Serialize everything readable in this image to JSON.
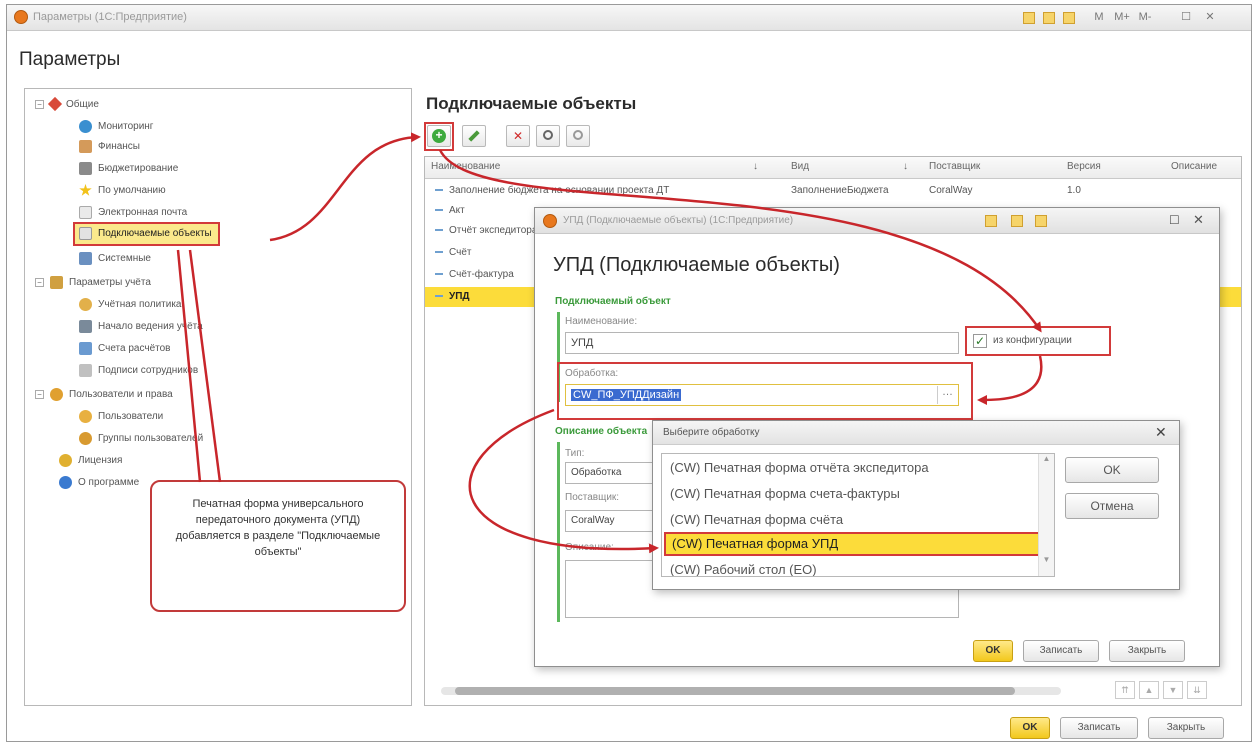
{
  "window": {
    "title": "Параметры (1С:Предприятие)",
    "tb_m": "M",
    "tb_mplus": "M+",
    "tb_mminus": "M-"
  },
  "page": {
    "title": "Параметры"
  },
  "tree": {
    "groups": [
      {
        "label": "Общие",
        "items": [
          "Мониторинг",
          "Финансы",
          "Бюджетирование",
          "По умолчанию",
          "Электронная почта",
          "Подключаемые объекты",
          "Системные"
        ]
      },
      {
        "label": "Параметры учёта",
        "items": [
          "Учётная политика",
          "Начало ведения учёта",
          "Счета расчётов",
          "Подписи сотрудников"
        ]
      },
      {
        "label": "Пользователи и права",
        "items": [
          "Пользователи",
          "Группы пользователей"
        ]
      }
    ],
    "extra": [
      "Лицензия",
      "О программе"
    ]
  },
  "section": {
    "title": "Подключаемые объекты"
  },
  "grid": {
    "columns": [
      "Наименование",
      "Вид",
      "Поставщик",
      "Версия",
      "Описание"
    ],
    "rows": [
      {
        "name": "Заполнение бюджета на основании проекта ДТ",
        "kind": "ЗаполнениеБюджета",
        "vendor": "CoralWay",
        "version": "1.0"
      },
      {
        "name": "Акт"
      },
      {
        "name": "Отчёт экспедитора"
      },
      {
        "name": "Счёт"
      },
      {
        "name": "Счёт-фактура"
      },
      {
        "name": "УПД"
      }
    ]
  },
  "main_buttons": {
    "ok": "OK",
    "save": "Записать",
    "close": "Закрыть"
  },
  "upd_dialog": {
    "title": "УПД (Подключаемые объекты) (1С:Предприятие)",
    "heading": "УПД (Подключаемые объекты)",
    "group1": "Подключаемый объект",
    "name_label": "Наименование:",
    "name_value": "УПД",
    "from_config_label": "из конфигурации",
    "processing_label": "Обработка:",
    "processing_value": "CW_ПФ_УПДДизайн",
    "group2": "Описание объекта",
    "type_label": "Тип:",
    "type_value": "Обработка",
    "vendor_label": "Поставщик:",
    "vendor_value": "CoralWay",
    "desc_label": "Описание:",
    "ok": "OK",
    "save": "Записать",
    "close": "Закрыть"
  },
  "select_dialog": {
    "title": "Выберите обработку",
    "items": [
      "(CW) Печатная форма отчёта экспедитора",
      "(CW) Печатная форма счета-фактуры",
      "(CW) Печатная форма счёта",
      "(CW) Печатная форма УПД",
      "(CW) Рабочий стол (ЕО)"
    ],
    "ok": "OK",
    "cancel": "Отмена"
  },
  "callout": {
    "text": "Печатная форма универсального передаточного документа (УПД) добавляется в разделе \"Подключаемые объекты\""
  },
  "colors": {
    "accent_red": "#c8262b",
    "selection": "#fcdc3a",
    "ok_button": "#f2c81c",
    "group_green": "#3a9a3a"
  }
}
